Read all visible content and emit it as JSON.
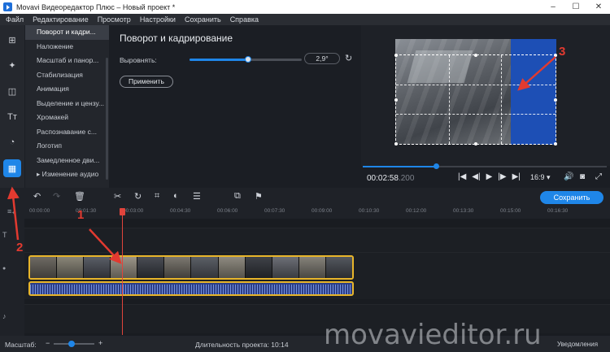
{
  "window": {
    "title": "Movavi Видеоредактор Плюс – Новый проект *",
    "controls": [
      "–",
      "☐",
      "✕"
    ]
  },
  "menu": [
    "Файл",
    "Редактирование",
    "Просмотр",
    "Настройки",
    "Сохранить",
    "Справка"
  ],
  "tools": [
    {
      "name": "import-icon",
      "glyph": "⊞"
    },
    {
      "name": "magic-icon",
      "glyph": "✦"
    },
    {
      "name": "transitions-icon",
      "glyph": "◫"
    },
    {
      "name": "titles-icon",
      "glyph": "Tт"
    },
    {
      "name": "filters-icon",
      "glyph": "◔"
    },
    {
      "name": "more-tools-icon",
      "glyph": "▦"
    }
  ],
  "categories": [
    "Поворот и кадри...",
    "Наложение",
    "Масштаб и панор...",
    "Стабилизация",
    "Анимация",
    "Выделение и цензу...",
    "Хромакей",
    "Распознавание с...",
    "Логотип",
    "Замедленное дви...",
    "▸ Изменение аудио"
  ],
  "panel": {
    "title": "Поворот и кадрирование",
    "align_label": "Выровнять:",
    "align_value": "2,9°",
    "align_fraction": 0.52,
    "apply_label": "Применить"
  },
  "player": {
    "timecode": "00:02:58",
    "timecode_ms": ".200",
    "progress": 0.3,
    "aspect": "16:9 ▾",
    "controls": [
      "|◀",
      "◀|",
      "▶",
      "|▶",
      "▶|"
    ]
  },
  "toolbar": {
    "save_label": "Сохранить"
  },
  "ruler": [
    "00:00:00",
    "00:01:30",
    "00:03:00",
    "00:04:30",
    "00:06:00",
    "00:07:30",
    "00:09:00",
    "00:10:30",
    "00:12:00",
    "00:13:30",
    "00:15:00",
    "00:16:30"
  ],
  "status": {
    "zoom_label": "Масштаб:",
    "duration": "Длительность проекта:  10:14",
    "notifications": "Уведомления"
  },
  "watermark": "movavieditor.ru",
  "annotations": [
    "1",
    "2",
    "3"
  ],
  "colors": {
    "accent": "#1f86e8",
    "clip_border": "#e8b52a",
    "playhead": "#e0443c",
    "annotation": "#e23a30"
  }
}
